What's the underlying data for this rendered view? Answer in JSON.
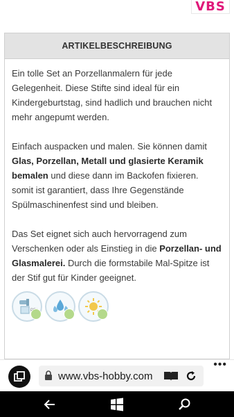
{
  "logo": {
    "text": "VBS"
  },
  "description": {
    "header": "ARTIKELBESCHREIBUNG",
    "p1": "Ein tolle Set an Porzellanmalern für jede Gelegenheit. Diese Stifte sind ideal für ein Kindergeburtstag, sind hadlich und brauchen nicht mehr angepumt werden.",
    "p2_a": "Einfach auspacken und malen. Sie können damit ",
    "p2_bold": "Glas, Porzellan, Metall und glasierte Keramik bemalen",
    "p2_b": " und diese dann im Backofen fixieren. somit ist garantiert, dass Ihre Gegenstände Spülmaschinenfest sind und bleiben.",
    "p3_a": "Das Set eignet sich auch hervorragend zum Verschenken oder als Einstieg in die ",
    "p3_bold": "Porzellan- und Glasmalerei.",
    "p3_b": " Durch die formstabile Mal-Spitze ist der Stif gut für Kinder geeignet.",
    "icons": [
      "dishwasher-safe-icon",
      "water-resistant-icon",
      "sun-resistant-icon"
    ]
  },
  "browser": {
    "url": "www.vbs-hobby.com",
    "more": "•••"
  },
  "colors": {
    "brand": "#e0197a",
    "header_bg": "#e3e3e3",
    "check": "#b4d98b",
    "icon_blue": "#5aa8d8",
    "sun": "#f2c84b"
  }
}
